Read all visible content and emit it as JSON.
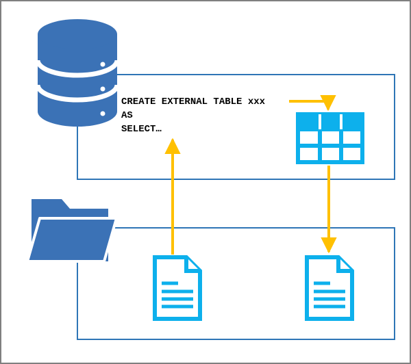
{
  "sql": {
    "line1": "CREATE EXTERNAL TABLE xxx",
    "line2": "AS",
    "line3": "SELECT…"
  },
  "colors": {
    "db_fill": "#3b72b6",
    "frame_stroke": "#2e75b6",
    "arrow": "#ffc000",
    "icon_blue": "#0db0ec",
    "canvas_border": "#7f7f7f"
  },
  "icons": {
    "database": "database-icon",
    "folder": "folder-icon",
    "file_left": "file-icon",
    "file_right": "file-icon",
    "table": "table-grid-icon"
  }
}
